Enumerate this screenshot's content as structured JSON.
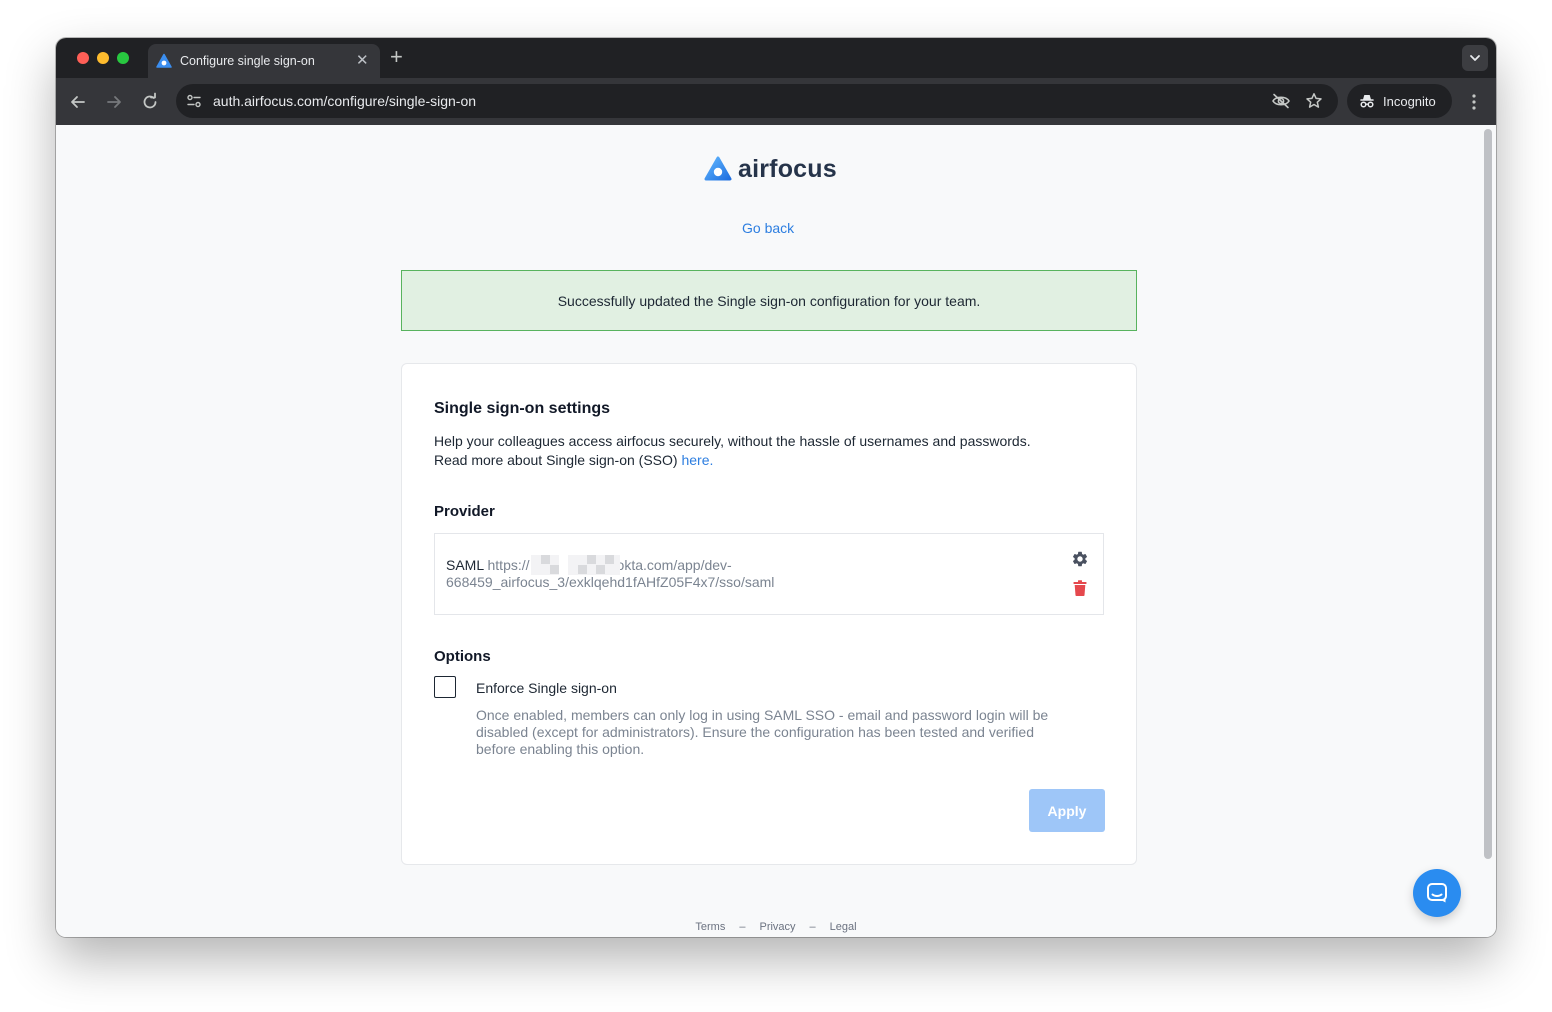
{
  "browser": {
    "tab": {
      "title": "Configure single sign-on",
      "close_glyph": "✕",
      "favicon": "airfocus-logo-icon"
    },
    "new_tab_glyph": "+",
    "url": "auth.airfocus.com/configure/single-sign-on",
    "incognito_label": "Incognito"
  },
  "page": {
    "brand": "airfocus",
    "go_back": "Go back",
    "alert": {
      "message": "Successfully updated the Single sign-on configuration for your team.",
      "background": "#e1f0e2",
      "border": "#58b35e"
    },
    "card": {
      "title": "Single sign-on settings",
      "description_line1": "Help your colleagues access airfocus securely, without the hassle of usernames and passwords.",
      "description_line2": "Read more about Single sign-on (SSO)",
      "description_link": "here.",
      "provider": {
        "heading": "Provider",
        "type": "SAML",
        "url_part1": "https://",
        "url_part2": "okta.com/app/dev-668459_airfocus_3/exklqehd1fAHfZ05F4x7/sso/saml",
        "edit_icon": "gear-icon",
        "delete_icon": "trash-icon"
      },
      "options": {
        "heading": "Options",
        "enforce_label": "Enforce Single sign-on",
        "enforce_checked": false,
        "enforce_help": "Once enabled, members can only log in using SAML SSO - email and password login will be disabled (except for administrators). Ensure the configuration has been tested and verified before enabling this option."
      },
      "apply_label": "Apply"
    },
    "footer": {
      "terms": "Terms",
      "privacy": "Privacy",
      "legal": "Legal",
      "separator": "–"
    }
  },
  "colors": {
    "accent": "#2d7ee0",
    "apply_disabled": "#9ec6f8",
    "delete": "#e5484d",
    "chat": "#2a8cf0"
  }
}
